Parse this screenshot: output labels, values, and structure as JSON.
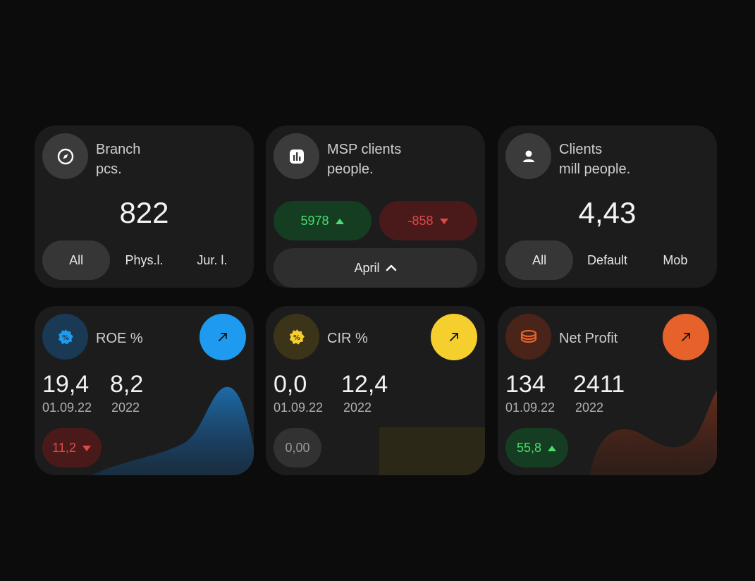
{
  "cards": {
    "branch": {
      "title_line1": "Branch",
      "title_line2": "pcs.",
      "value": "822",
      "icon": "compass-icon",
      "tabs": [
        "All",
        "Phys.l.",
        "Jur. l."
      ],
      "active_tab": "All"
    },
    "msp": {
      "title_line1": "MSP clients",
      "title_line2": "people.",
      "icon": "bar-chart-icon",
      "up_value": "5978",
      "down_value": "-858",
      "month": "April"
    },
    "clients": {
      "title_line1": "Clients",
      "title_line2": "mill people.",
      "value": "4,43",
      "icon": "user-icon",
      "tabs": [
        "All",
        "Default",
        "Mob"
      ],
      "active_tab": "All"
    },
    "roe": {
      "title": "ROE %",
      "icon": "percent-badge-icon",
      "value1": "19,4",
      "label1": "01.09.22",
      "value2": "8,2",
      "label2": "2022",
      "change": "11,2",
      "change_direction": "down",
      "accent": "#1e9bf0"
    },
    "cir": {
      "title": "CIR %",
      "icon": "percent-badge-icon",
      "value1": "0,0",
      "label1": "01.09.22",
      "value2": "12,4",
      "label2": "2022",
      "change": "0,00",
      "change_direction": "none",
      "accent": "#f5cf2e"
    },
    "net_profit": {
      "title": "Net Profit",
      "icon": "coins-icon",
      "value1": "134",
      "label1": "01.09.22",
      "value2": "2411",
      "label2": "2022",
      "change": "55,8",
      "change_direction": "up",
      "accent": "#e6622a"
    }
  }
}
